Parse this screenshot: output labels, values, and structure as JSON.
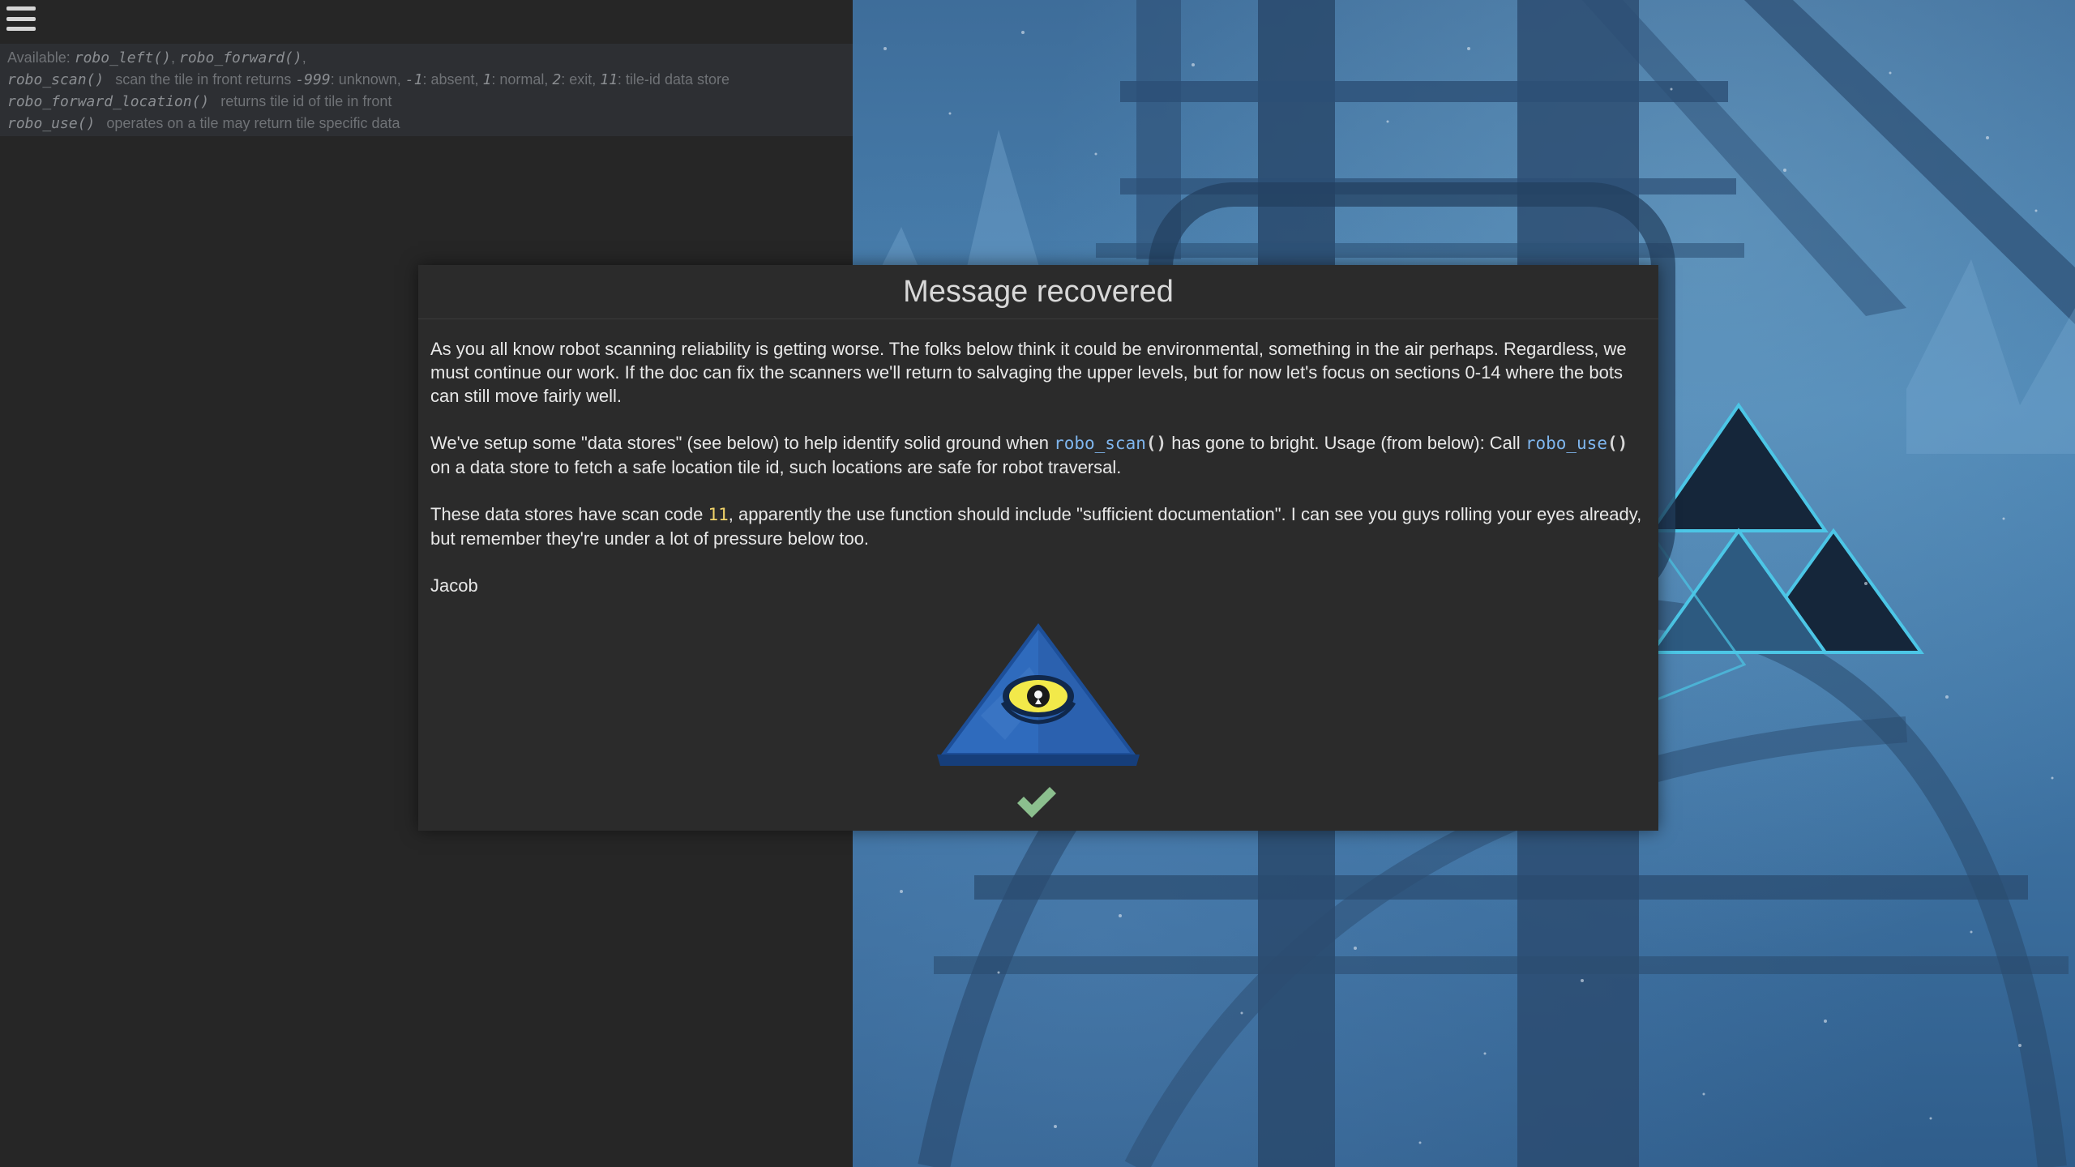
{
  "docs": {
    "available_prefix": "Available:",
    "available_fns": [
      "robo_left()",
      "robo_forward()"
    ],
    "lines": [
      {
        "fn": "robo_scan()",
        "desc_parts": [
          {
            "t": "scan the tile in front returns ",
            "c": false
          },
          {
            "t": "-999",
            "c": true
          },
          {
            "t": ": unknown, ",
            "c": false
          },
          {
            "t": "-1",
            "c": true
          },
          {
            "t": ": absent, ",
            "c": false
          },
          {
            "t": "1",
            "c": true
          },
          {
            "t": ": normal, ",
            "c": false
          },
          {
            "t": "2",
            "c": true
          },
          {
            "t": ": exit, ",
            "c": false
          },
          {
            "t": "11",
            "c": true
          },
          {
            "t": ": tile-id data store",
            "c": false
          }
        ]
      },
      {
        "fn": "robo_forward_location()",
        "desc_parts": [
          {
            "t": "returns tile id of tile in front",
            "c": false
          }
        ]
      },
      {
        "fn": "robo_use()",
        "desc_parts": [
          {
            "t": "operates on a tile may return tile specific data",
            "c": false
          }
        ]
      }
    ]
  },
  "modal": {
    "title": "Message recovered",
    "p1": "As you all know robot scanning reliability is getting worse. The folks below think it could be environmental, something in the air perhaps. Regardless, we must continue our work. If the doc can fix the scanners we'll return to salvaging the upper levels, but for now let's focus on sections 0-14 where the bots can still move fairly well.",
    "p2_a": "We've setup some \"data stores\" (see below) to help identify solid ground when ",
    "p2_code1_name": "robo_scan",
    "p2_code1_paren": "()",
    "p2_b": " has gone to bright. Usage (from below): Call ",
    "p2_code2_name": "robo_use",
    "p2_code2_paren": "()",
    "p2_c": " on a data store to fetch a safe location tile id, such locations are safe for robot traversal.",
    "p3_a": "These data stores have scan code ",
    "p3_code": "11",
    "p3_b": ", apparently the use function should include \"sufficient documentation\". I can see you guys rolling your eyes already, but remember they're under a lot of pressure below too.",
    "signature": "Jacob",
    "badge_icon": "pyramid-eye-icon",
    "confirm_icon": "checkmark-icon"
  },
  "colors": {
    "page_bg": "#262626",
    "docs_bg": "#2d2f33",
    "modal_bg": "#2b2b2b",
    "code_blue": "#7fb6ee",
    "code_yellow": "#f0d36a",
    "check_green": "#8bbf8e",
    "scene_blue": "#4a83b2"
  }
}
